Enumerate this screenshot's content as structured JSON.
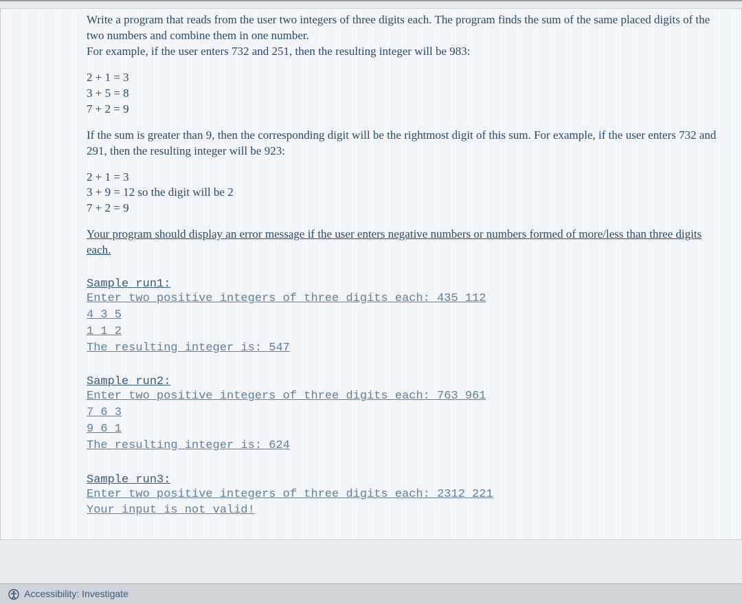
{
  "problem": {
    "intro": "Write a program that reads from the user two integers of three digits each. The program finds the sum of the same placed digits of the two numbers and combine them in one number.",
    "example1_intro": "For example, if the user enters 732 and 251, then the resulting integer will be 983:",
    "equations1": [
      "2 + 1 = 3",
      "3 + 5 = 8",
      "7 + 2 = 9"
    ],
    "example2_intro": "If the sum is greater than 9, then the corresponding digit will be the rightmost digit of this sum. For example, if the user enters 732 and 291, then the resulting integer will be 923:",
    "equations2": [
      "2 + 1 = 3",
      "3 + 9 = 12 so the digit will be 2",
      "7 + 2 = 9"
    ],
    "error_msg": "Your program should display an error message if the user enters negative numbers or numbers formed of more/less than three digits each."
  },
  "samples": {
    "run1": {
      "title": "Sample run1:",
      "lines": [
        "Enter two positive integers of three digits each: 435 112",
        "4 3 5",
        "1 1 2",
        "The resulting integer is: 547"
      ]
    },
    "run2": {
      "title": "Sample run2:",
      "lines": [
        "Enter two positive integers of three digits each: 763 961",
        "7 6 3",
        "9 6 1",
        "The resulting integer is: 624"
      ]
    },
    "run3": {
      "title": "Sample run3:",
      "lines": [
        "Enter two positive integers of three digits each: 2312 221",
        "Your input is not valid!"
      ]
    }
  },
  "footer": {
    "accessibility": "Accessibility: Investigate"
  }
}
